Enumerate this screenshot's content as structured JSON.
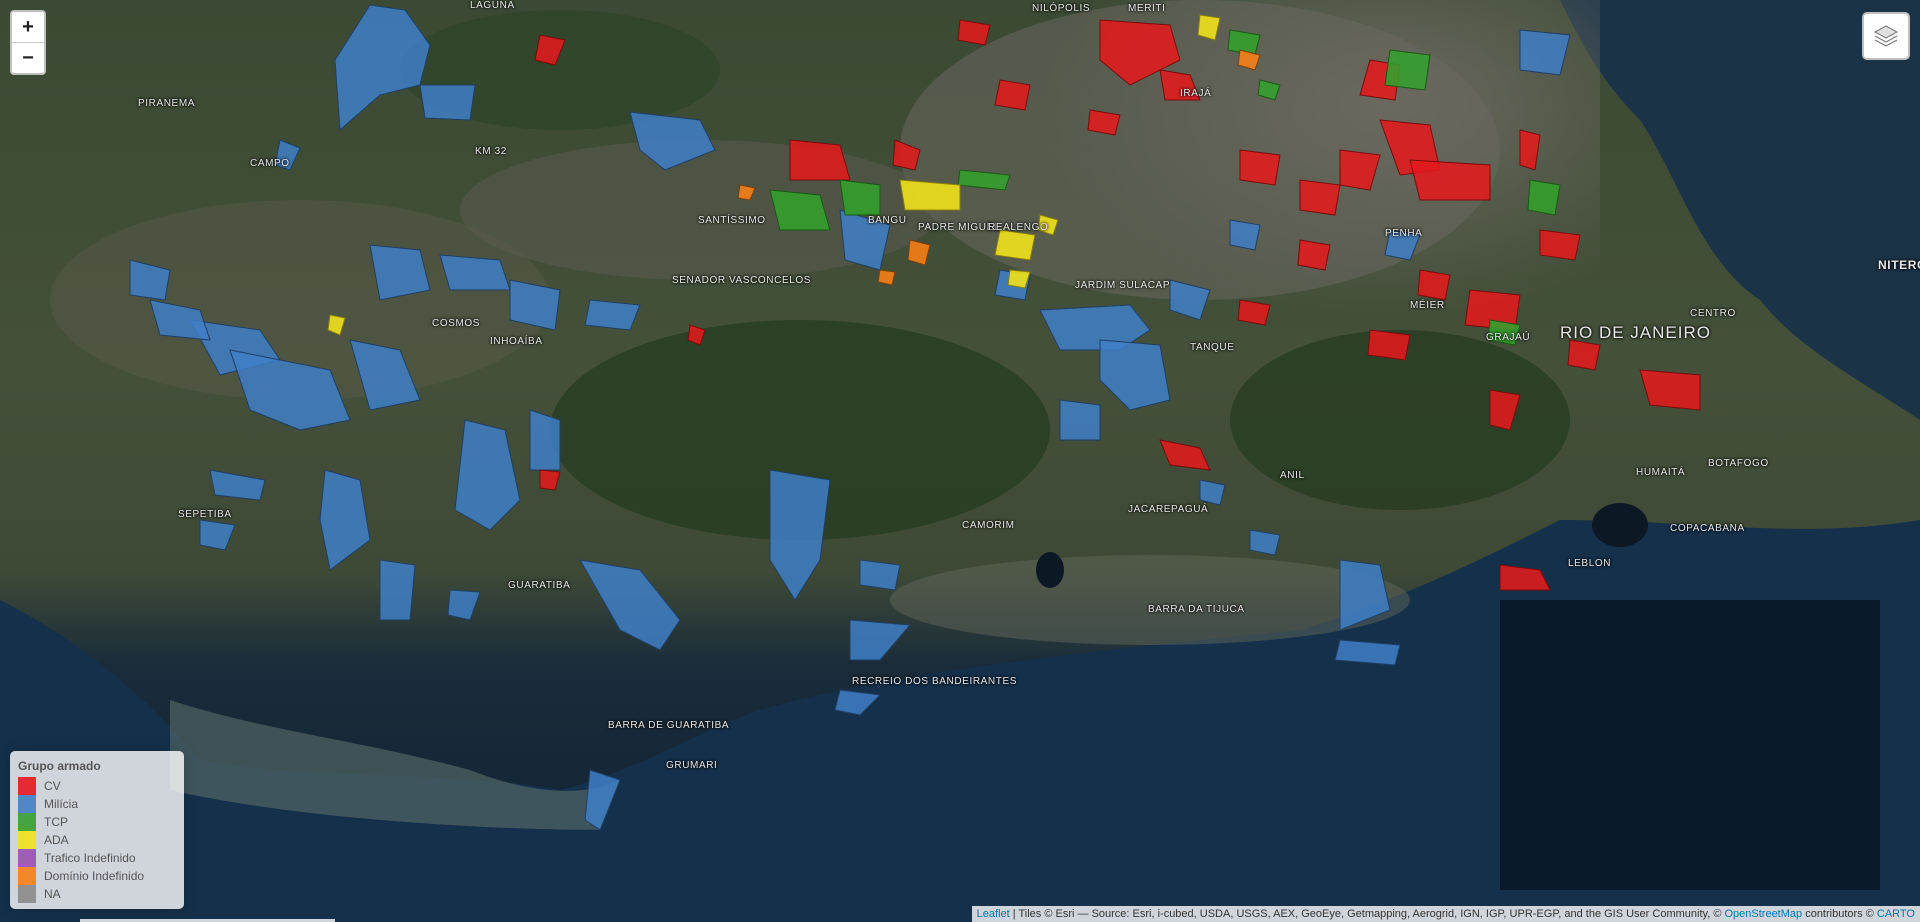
{
  "map": {
    "place_labels": [
      {
        "text": "Nilópolis",
        "cls": "mid"
      },
      {
        "text": "Meriti",
        "cls": "mid"
      },
      {
        "text": "Laguna",
        "cls": ""
      },
      {
        "text": "Piranema",
        "cls": ""
      },
      {
        "text": "Campo",
        "cls": ""
      },
      {
        "text": "Km 32",
        "cls": ""
      },
      {
        "text": "Santíssimo",
        "cls": ""
      },
      {
        "text": "Bangu",
        "cls": ""
      },
      {
        "text": "Padre Miguel",
        "cls": ""
      },
      {
        "text": "Realengo",
        "cls": ""
      },
      {
        "text": "Senador Vasconcelos",
        "cls": ""
      },
      {
        "text": "Cosmos",
        "cls": ""
      },
      {
        "text": "Inhoaíba",
        "cls": ""
      },
      {
        "text": "Jardim Sulacap",
        "cls": ""
      },
      {
        "text": "Tanque",
        "cls": ""
      },
      {
        "text": "Anil",
        "cls": ""
      },
      {
        "text": "Jacarepaguá",
        "cls": ""
      },
      {
        "text": "Camorim",
        "cls": ""
      },
      {
        "text": "Barra da Tijuca",
        "cls": ""
      },
      {
        "text": "Recreio dos Bandeirantes",
        "cls": ""
      },
      {
        "text": "Sepetiba",
        "cls": ""
      },
      {
        "text": "Guaratiba",
        "cls": ""
      },
      {
        "text": "Barra de Guaratiba",
        "cls": ""
      },
      {
        "text": "Grumari",
        "cls": ""
      },
      {
        "text": "Rio de Janeiro",
        "cls": "big"
      },
      {
        "text": "Centro",
        "cls": ""
      },
      {
        "text": "Humaitá",
        "cls": ""
      },
      {
        "text": "Botafogo",
        "cls": ""
      },
      {
        "text": "Copacabana",
        "cls": ""
      },
      {
        "text": "Leblon",
        "cls": ""
      },
      {
        "text": "Méier",
        "cls": ""
      },
      {
        "text": "Irajá",
        "cls": ""
      },
      {
        "text": "Penha",
        "cls": ""
      },
      {
        "text": "Niterói",
        "cls": "mid"
      },
      {
        "text": "Grajaú",
        "cls": ""
      }
    ]
  },
  "zoom": {
    "in_label": "+",
    "out_label": "−"
  },
  "layers_control": {
    "icon": "layers-icon"
  },
  "legend": {
    "title": "Grupo armado",
    "items": [
      {
        "label": "CV",
        "color": "#e31a1c"
      },
      {
        "label": "Milícia",
        "color": "#3f7fc7"
      },
      {
        "label": "TCP",
        "color": "#33a02c"
      },
      {
        "label": "ADA",
        "color": "#f1e21d"
      },
      {
        "label": "Trafico Indefinido",
        "color": "#9b4fb3"
      },
      {
        "label": "Domínio Indefinido",
        "color": "#f57f17"
      },
      {
        "label": "NA",
        "color": "#8a8a8a"
      }
    ]
  },
  "attribution": {
    "leaflet": "Leaflet",
    "tiles_text": " | Tiles © Esri — Source: Esri, i-cubed, USDA, USGS, AEX, GeoEye, Getmapping, Aerogrid, IGN, IGP, UPR-EGP, and the GIS User Community, © ",
    "osm": "OpenStreetMap",
    "contributors": " contributors © ",
    "carto": "CARTO"
  }
}
